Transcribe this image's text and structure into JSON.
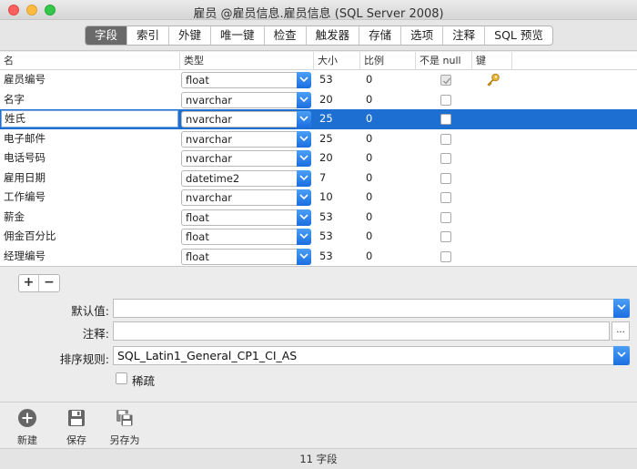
{
  "window": {
    "title": "雇员 @雇员信息.雇员信息 (SQL Server 2008)"
  },
  "tabs": [
    {
      "label": "字段",
      "active": true
    },
    {
      "label": "索引"
    },
    {
      "label": "外键"
    },
    {
      "label": "唯一键"
    },
    {
      "label": "检查"
    },
    {
      "label": "触发器"
    },
    {
      "label": "存储"
    },
    {
      "label": "选项"
    },
    {
      "label": "注释"
    },
    {
      "label": "SQL 预览"
    }
  ],
  "grid": {
    "headers": {
      "name": "名",
      "type": "类型",
      "size": "大小",
      "scale": "比例",
      "not_null": "不是 null",
      "key": "键"
    },
    "rows": [
      {
        "name": "雇员编号",
        "type": "float",
        "size": "53",
        "scale": "0",
        "not_null": true,
        "key": true
      },
      {
        "name": "名字",
        "type": "nvarchar",
        "size": "20",
        "scale": "0",
        "not_null": false
      },
      {
        "name": "姓氏",
        "type": "nvarchar",
        "size": "25",
        "scale": "0",
        "not_null": false,
        "selected": true
      },
      {
        "name": "电子邮件",
        "type": "nvarchar",
        "size": "25",
        "scale": "0",
        "not_null": false
      },
      {
        "name": "电话号码",
        "type": "nvarchar",
        "size": "20",
        "scale": "0",
        "not_null": false
      },
      {
        "name": "雇用日期",
        "type": "datetime2",
        "size": "7",
        "scale": "0",
        "not_null": false
      },
      {
        "name": "工作编号",
        "type": "nvarchar",
        "size": "10",
        "scale": "0",
        "not_null": false
      },
      {
        "name": "薪金",
        "type": "float",
        "size": "53",
        "scale": "0",
        "not_null": false
      },
      {
        "name": "佣金百分比",
        "type": "float",
        "size": "53",
        "scale": "0",
        "not_null": false
      },
      {
        "name": "经理编号",
        "type": "float",
        "size": "53",
        "scale": "0",
        "not_null": false
      }
    ]
  },
  "row_buttons": {
    "add": "+",
    "remove": "−"
  },
  "properties": {
    "default_label": "默认值:",
    "default_value": "",
    "comment_label": "注释:",
    "comment_value": "",
    "comment_button": "...",
    "collation_label": "排序规则:",
    "collation_value": "SQL_Latin1_General_CP1_CI_AS",
    "sparse_label": "稀疏"
  },
  "bottom_toolbar": {
    "new": "新建",
    "save": "保存",
    "save_as": "另存为"
  },
  "status": "11 字段",
  "icons": {
    "key": "key-icon",
    "new": "plus-circle-icon",
    "save": "floppy-disk-icon",
    "save_as": "save-as-icon"
  },
  "colors": {
    "selection": "#1d6fd1",
    "accent": "#1b6ee0"
  }
}
